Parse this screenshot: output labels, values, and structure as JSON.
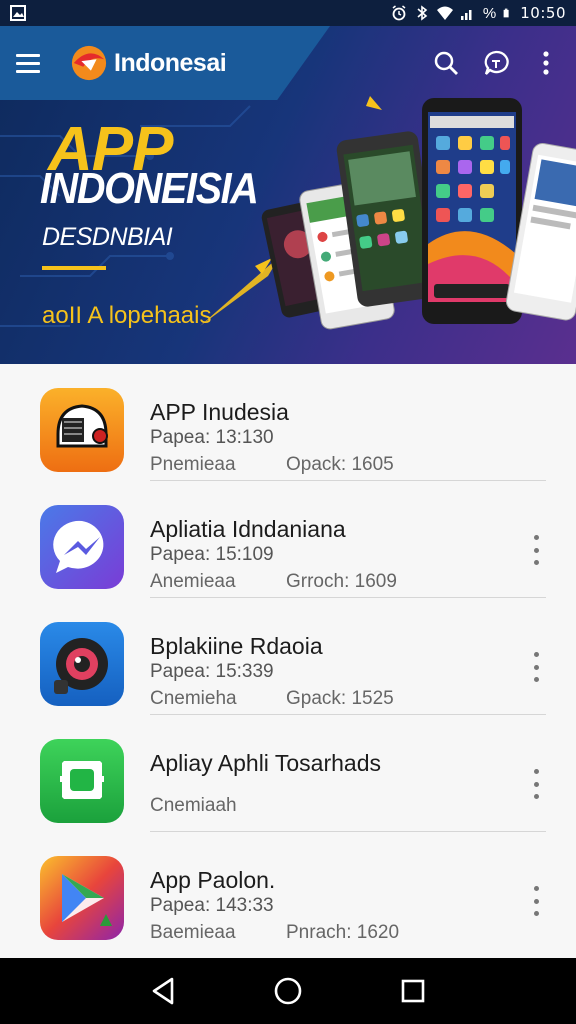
{
  "status_bar": {
    "time": "10:50",
    "icons": [
      "image-icon",
      "alarm-icon",
      "bluetooth-icon",
      "wifi-icon",
      "signal-icon",
      "battery-icon"
    ],
    "battery_label": "%"
  },
  "header": {
    "brand_name": "Indonesai",
    "menu_icon": "hamburger-menu-icon",
    "actions": [
      "search-icon",
      "chat-icon",
      "more-vert-icon"
    ]
  },
  "hero": {
    "title_line1": "APP",
    "title_line2": "INDONEISIA",
    "subtitle": "DESDNBIAI",
    "tagline": "aoII A lopehaais",
    "colors": {
      "accent": "#f6c21b",
      "background": "#17357a"
    }
  },
  "apps": [
    {
      "title": "APP Inudesia",
      "sub": "Papea: 13:130",
      "category": "Pnemieaa",
      "extra": "Opack: 1605",
      "icon": "helmet-app-icon",
      "has_more": false
    },
    {
      "title": "Apliatia Idndaniana",
      "sub": "Papea: 15:109",
      "category": "Anemieaa",
      "extra": "Grroch: 1609",
      "icon": "messenger-app-icon",
      "has_more": true
    },
    {
      "title": "Bplakiine Rdaoia",
      "sub": "Papea: 15:339",
      "category": "Cnemieha",
      "extra": "Gpack: 1525",
      "icon": "camera-app-icon",
      "has_more": true
    },
    {
      "title": "Apliay Aphli Tosarhads",
      "sub": "",
      "category": "Cnemiaah",
      "extra": "",
      "icon": "chat-square-app-icon",
      "has_more": true
    },
    {
      "title": "App Paolon.",
      "sub": "Papea: 143:33",
      "category": "Baemieaa",
      "extra": "Pnrach: 1620",
      "icon": "play-app-icon",
      "has_more": true
    }
  ],
  "nav_bar": {
    "buttons": [
      "back-icon",
      "home-icon",
      "recents-icon"
    ]
  }
}
